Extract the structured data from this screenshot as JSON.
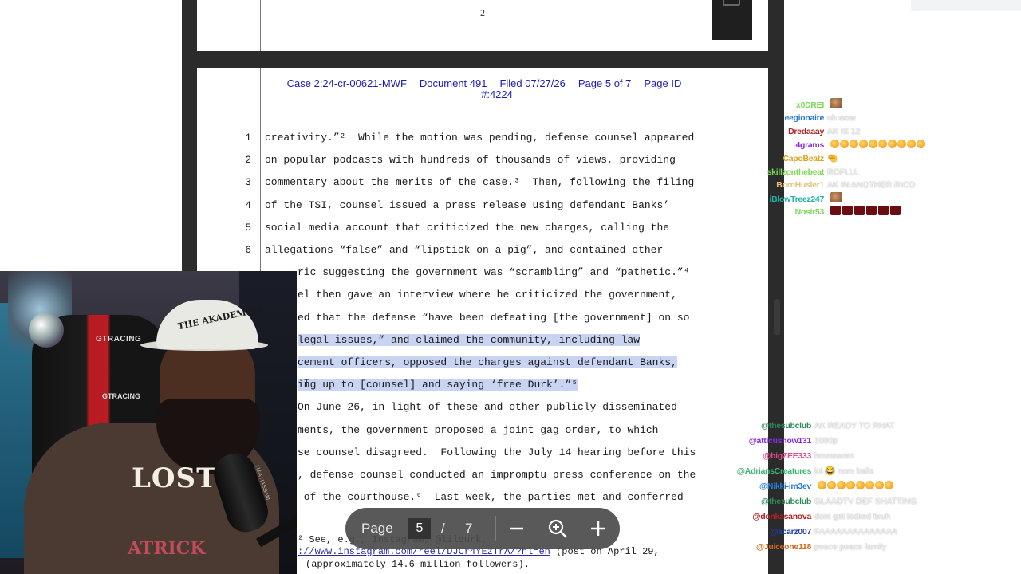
{
  "viewer": {
    "prev_page_number": "2",
    "header": {
      "case": "Case 2:24-cr-00621-MWF",
      "document": "Document 491",
      "filed": "Filed 07/27/26",
      "page": "Page 5 of 7",
      "page_id_a": "Page ID",
      "page_id_b": "#:4224"
    },
    "lines": [
      {
        "n": "1",
        "text": "creativity.”²  While the motion was pending, defense counsel appeared"
      },
      {
        "n": "2",
        "text": "on popular podcasts with hundreds of thousands of views, providing"
      },
      {
        "n": "3",
        "text": "commentary about the merits of the case.³  Then, following the filing"
      },
      {
        "n": "4",
        "text": "of the TSI, counsel issued a press release using defendant Banks’"
      },
      {
        "n": "5",
        "text": "social media account that criticized the new charges, calling the"
      },
      {
        "n": "6",
        "text": "allegations “false” and “lipstick on a pig”, and contained other"
      },
      {
        "n": "",
        "text": "ric suggesting the government was “scrambling” and “pathetic.”⁴"
      },
      {
        "n": "",
        "text": "el then gave an interview where he criticized the government,"
      },
      {
        "n": "",
        "text": "ed that the defense “have been defeating [the government] on so"
      },
      {
        "n": "",
        "text": "legal issues,” and claimed the community, including law"
      },
      {
        "n": "",
        "text": "cement officers, opposed the charges against defendant Banks,"
      },
      {
        "n": "",
        "text": "ing up to [counsel] and saying ‘free Durk’.”⁵"
      },
      {
        "n": "",
        "text": "On June 26, in light of these and other publicly disseminated"
      },
      {
        "n": "",
        "text": "ments, the government proposed a joint gag order, to which"
      },
      {
        "n": "",
        "text": "se counsel disagreed.  Following the July 14 hearing before this"
      },
      {
        "n": "",
        "text": ", defense counsel conducted an impromptu press conference on the"
      },
      {
        "n": "",
        "text": " of the courthouse.⁶  Last week, the parties met and conferred"
      }
    ],
    "footnote_a": "² See, e.g., Instagram, @lildurk,",
    "footnote_link": "://www.instagram.com/reel/DJCr4YEzTrA/?hl=en",
    "footnote_b": " (post on April 29,",
    "footnote_c": "(approximately 14.6 million followers)."
  },
  "toolbar": {
    "page_label": "Page",
    "current_page": "5",
    "separator": "/",
    "total_pages": "7",
    "zoom_out_icon": "minus-icon",
    "zoom_icon": "magnifier-icon",
    "zoom_in_icon": "plus-icon"
  },
  "webcam": {
    "cap_text": "THE AKADEMIKS",
    "shirt_text": "LOST",
    "shirt_text2": "ATRICK",
    "chair_brand": "GTRACING",
    "chair_brand2": "GTRACING",
    "mic_label": "H&A HASSAM"
  },
  "chat_top": [
    {
      "user": "x0DREI",
      "color": "#7ed957",
      "msg": "",
      "emote": "face"
    },
    {
      "user": "eegionaire",
      "color": "#2a7bd6",
      "msg": "oh wow"
    },
    {
      "user": "Dredaaay",
      "color": "#b22222",
      "msg": "AK IS 12"
    },
    {
      "user": "4grams",
      "color": "#8a2be2",
      "msg": "",
      "emote": "lol",
      "count": 10
    },
    {
      "user": "CapoBeatz",
      "color": "#daa520",
      "msg": "🤏"
    },
    {
      "user": "skillzonthebeat",
      "color": "#7ed957",
      "msg": "ROFLLL"
    },
    {
      "user": "BornHusler1",
      "color": "#e8c07a",
      "msg": "AK IN ANOTHER RICO"
    },
    {
      "user": "iBlowTreez247",
      "color": "#20b2aa",
      "msg": "",
      "emote": "face"
    },
    {
      "user": "Nosir53",
      "color": "#7ed957",
      "msg": "",
      "emote": "skull",
      "count": 6
    }
  ],
  "chat_bottom": [
    {
      "user": "@thesubclub",
      "color": "#2e8b57",
      "msg": "AK READY TO RHAT"
    },
    {
      "user": "@atticusnow131",
      "color": "#8a2be2",
      "msg": "1080p"
    },
    {
      "user": "@bigZEE333",
      "color": "#e04a8a",
      "msg": "hmmmmm"
    },
    {
      "user": "@AdriansCreatures",
      "color": "#3cb371",
      "msg": "lol 😂 nom balls"
    },
    {
      "user": "@Nikki-im3ev",
      "color": "#2a7bd6",
      "msg": "",
      "emote": "lol",
      "count": 8
    },
    {
      "user": "@thesubclub",
      "color": "#2e8b57",
      "msg": "GLAADTV DEF SHATTING"
    },
    {
      "user": "@donkasanova",
      "color": "#b22222",
      "msg": "dont get locked bruh"
    },
    {
      "user": "@acarz007",
      "color": "#1e3ea8",
      "msg": "FAAAAAAAAAAAAAA"
    },
    {
      "user": "@Juiceone118",
      "color": "#d2691e",
      "msg": "peace peace family"
    }
  ]
}
